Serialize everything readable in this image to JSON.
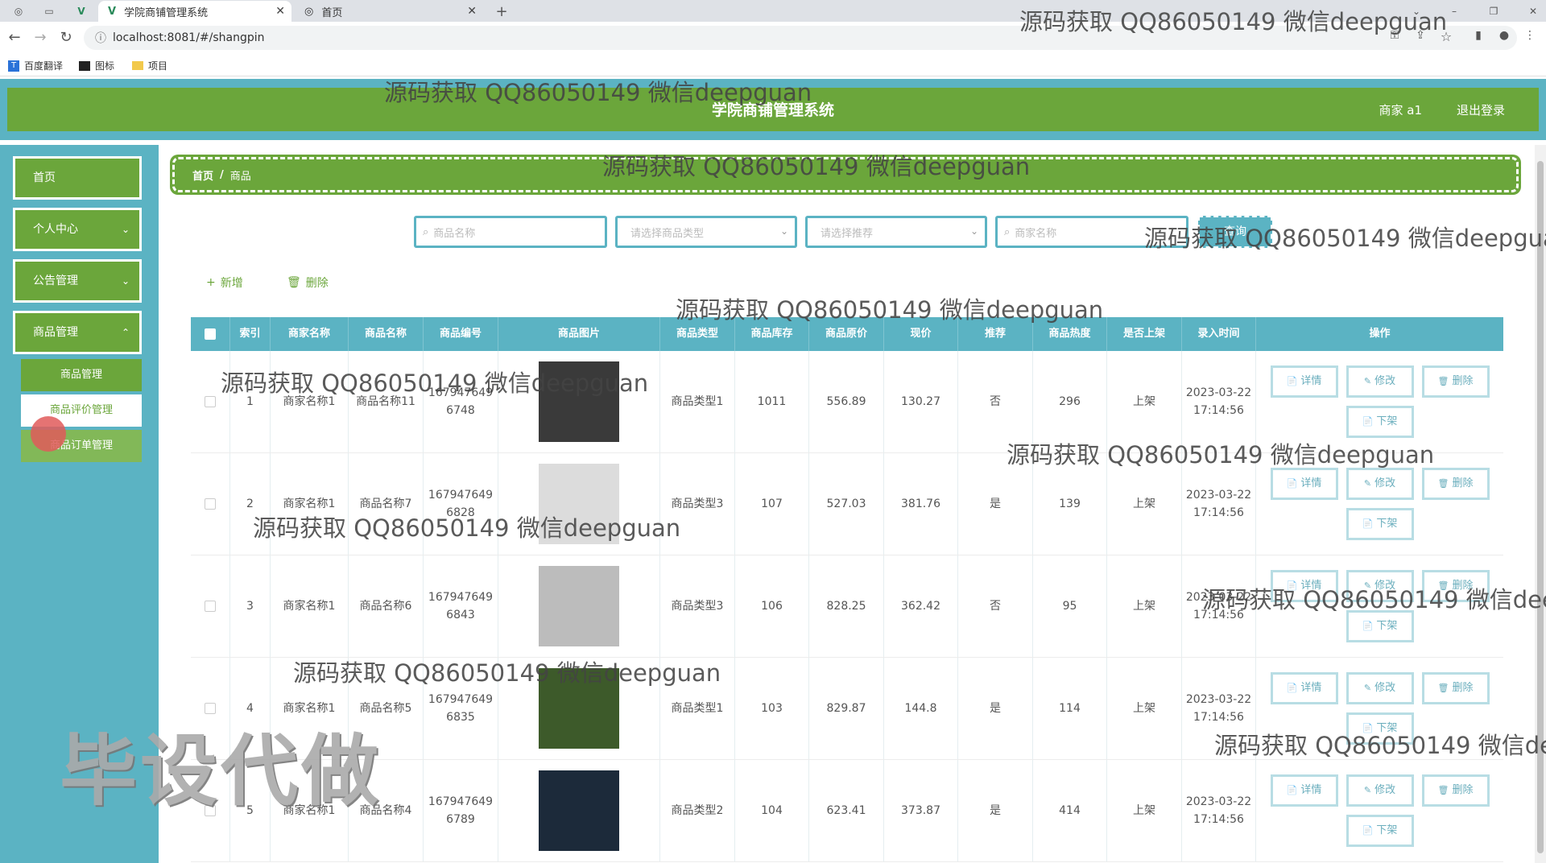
{
  "browser": {
    "tabs": [
      {
        "title": "学院商铺管理系统",
        "active": true
      },
      {
        "title": "首页",
        "active": false
      }
    ],
    "url": "localhost:8081/#/shangpin",
    "bookmarks": [
      "百度翻译",
      "图标",
      "项目"
    ]
  },
  "header": {
    "title": "学院商铺管理系统",
    "user": "商家 a1",
    "logout": "退出登录"
  },
  "sidebar": {
    "items": [
      {
        "label": "首页"
      },
      {
        "label": "个人中心"
      },
      {
        "label": "公告管理"
      },
      {
        "label": "商品管理"
      }
    ],
    "sub_items": [
      {
        "label": "商品管理"
      },
      {
        "label": "商品评价管理"
      },
      {
        "label": "商品订单管理"
      }
    ]
  },
  "breadcrumb": {
    "home": "首页",
    "sep": "/",
    "current": "商品"
  },
  "filters": {
    "name_placeholder": "商品名称",
    "type_placeholder": "请选择商品类型",
    "recommend_placeholder": "请选择推荐",
    "merchant_placeholder": "商家名称",
    "search_label": "查询"
  },
  "toolbar": {
    "add": "新增",
    "delete": "删除"
  },
  "table": {
    "headers": [
      "索引",
      "商家名称",
      "商品名称",
      "商品编号",
      "商品图片",
      "商品类型",
      "商品库存",
      "商品原价",
      "现价",
      "推荐",
      "商品热度",
      "是否上架",
      "录入时间",
      "操作"
    ],
    "rows": [
      {
        "index": "1",
        "merchant": "商家名称1",
        "name": "商品名称11",
        "code": "1679476496748",
        "type": "商品类型1",
        "stock": "1011",
        "orig": "556.89",
        "price": "130.27",
        "rec": "否",
        "heat": "296",
        "onsale": "上架",
        "time": "2023-03-22 17:14:56"
      },
      {
        "index": "2",
        "merchant": "商家名称1",
        "name": "商品名称7",
        "code": "1679476496828",
        "type": "商品类型3",
        "stock": "107",
        "orig": "527.03",
        "price": "381.76",
        "rec": "是",
        "heat": "139",
        "onsale": "上架",
        "time": "2023-03-22 17:14:56"
      },
      {
        "index": "3",
        "merchant": "商家名称1",
        "name": "商品名称6",
        "code": "1679476496843",
        "type": "商品类型3",
        "stock": "106",
        "orig": "828.25",
        "price": "362.42",
        "rec": "否",
        "heat": "95",
        "onsale": "上架",
        "time": "2023-03-22 17:14:56"
      },
      {
        "index": "4",
        "merchant": "商家名称1",
        "name": "商品名称5",
        "code": "1679476496835",
        "type": "商品类型1",
        "stock": "103",
        "orig": "829.87",
        "price": "144.8",
        "rec": "是",
        "heat": "114",
        "onsale": "上架",
        "time": "2023-03-22 17:14:56"
      },
      {
        "index": "5",
        "merchant": "商家名称1",
        "name": "商品名称4",
        "code": "1679476496789",
        "type": "商品类型2",
        "stock": "104",
        "orig": "623.41",
        "price": "373.87",
        "rec": "是",
        "heat": "414",
        "onsale": "上架",
        "time": "2023-03-22 17:14:56"
      }
    ],
    "actions": {
      "detail": "详情",
      "edit": "修改",
      "delete": "删除",
      "offshelf": "下架"
    }
  },
  "watermarks": {
    "text": "源码获取 QQ86050149 微信deepguan",
    "big": "毕设代做"
  },
  "colors": {
    "teal": "#5bb3c3",
    "green": "#6ba63b"
  }
}
